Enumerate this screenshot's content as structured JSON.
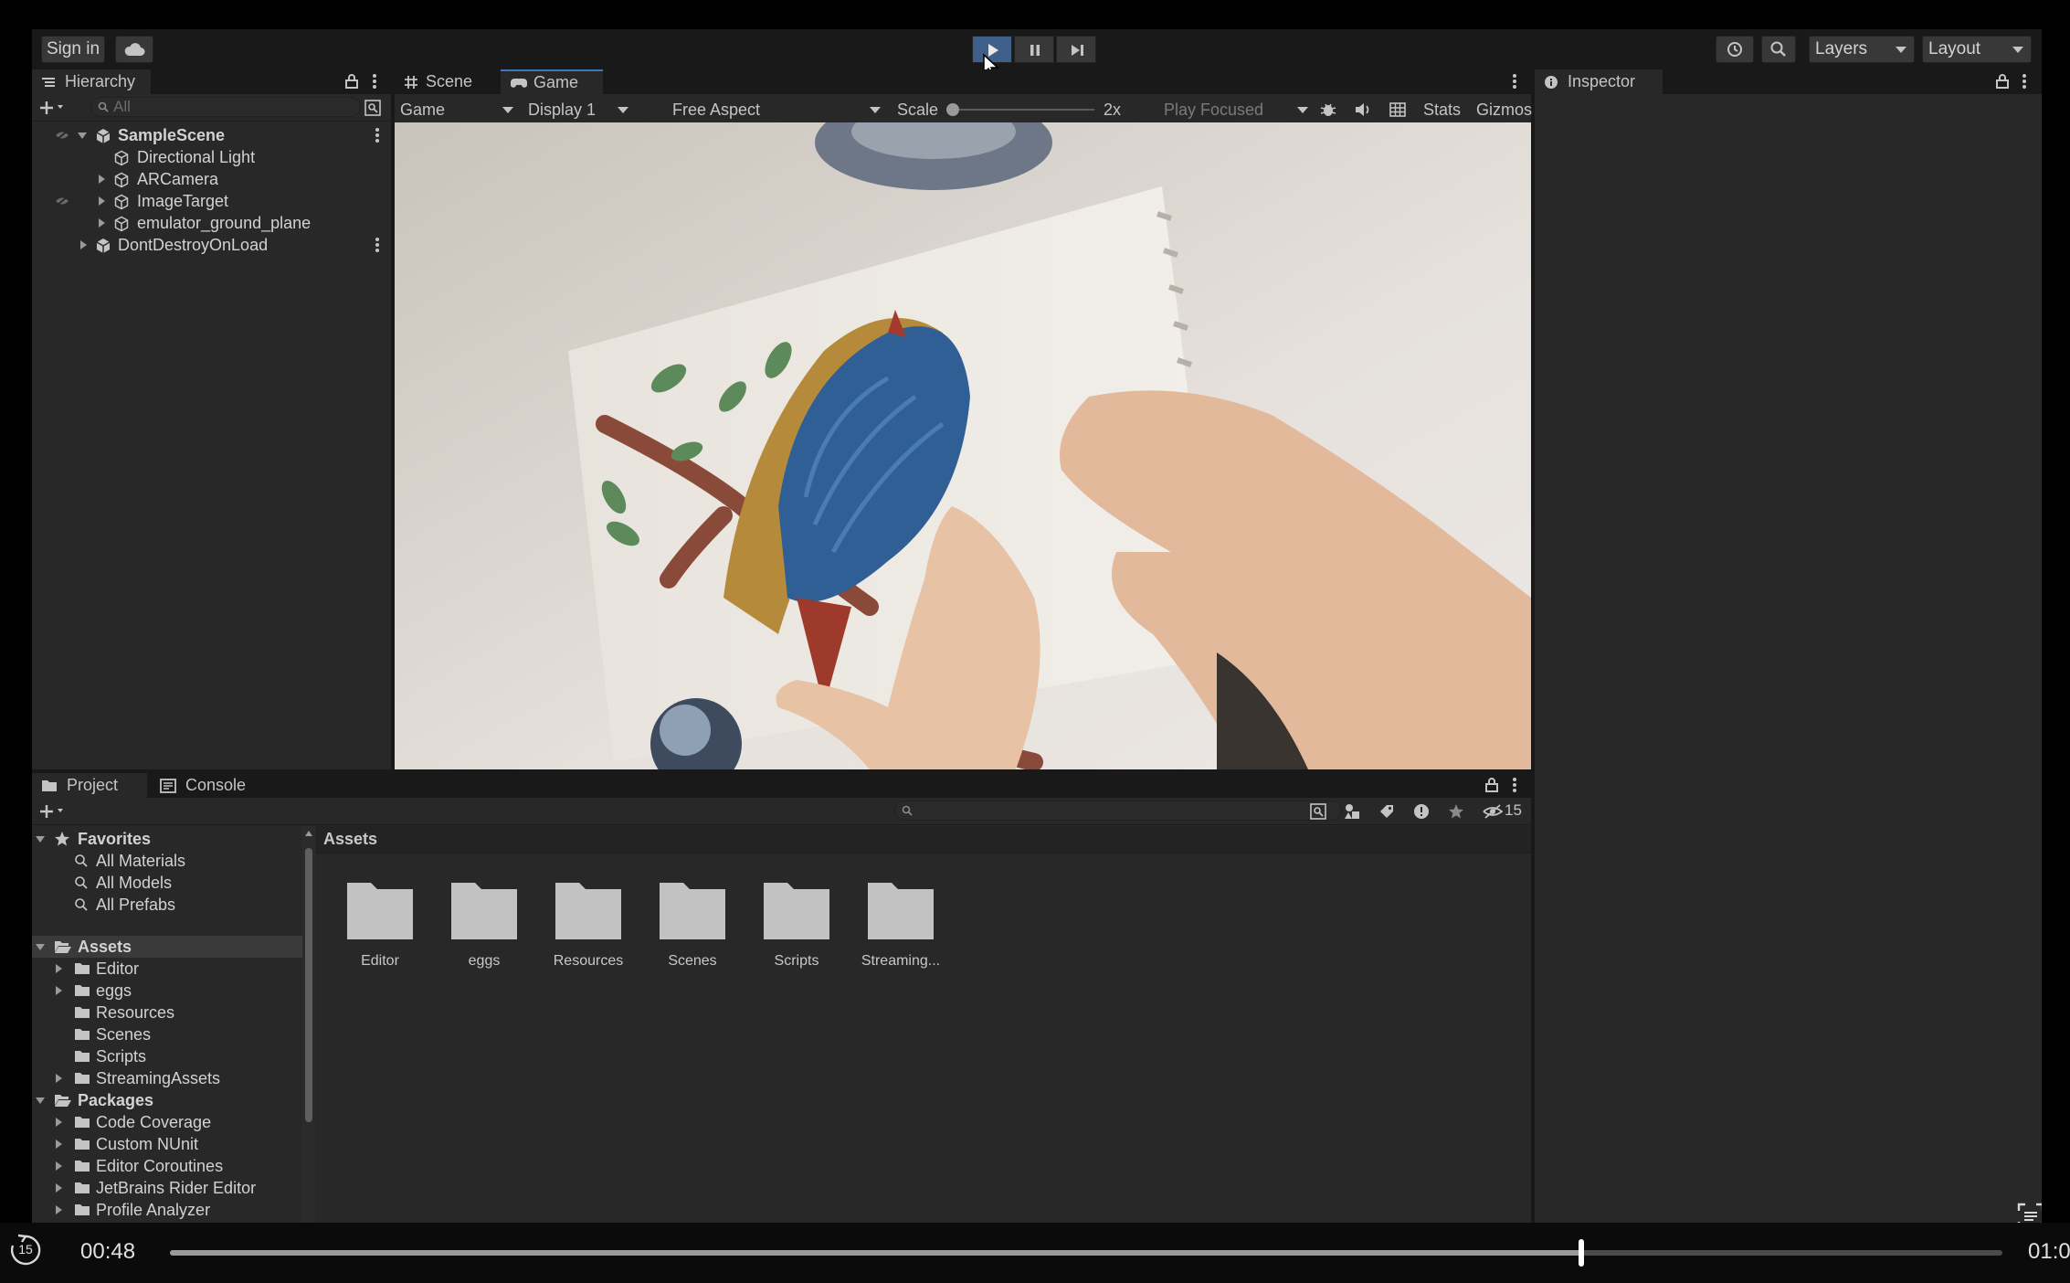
{
  "toolbar": {
    "sign_in": "Sign in",
    "layers": "Layers",
    "layout": "Layout"
  },
  "hierarchy": {
    "tab": "Hierarchy",
    "search_placeholder": "All",
    "items": [
      {
        "label": "SampleScene"
      },
      {
        "label": "Directional Light"
      },
      {
        "label": "ARCamera"
      },
      {
        "label": "ImageTarget"
      },
      {
        "label": "emulator_ground_plane"
      },
      {
        "label": "DontDestroyOnLoad"
      }
    ]
  },
  "scene_tabs": {
    "scene": "Scene",
    "game": "Game"
  },
  "game_toolbar": {
    "mode": "Game",
    "display": "Display 1",
    "aspect": "Free Aspect",
    "scale_label": "Scale",
    "scale_value": "2x",
    "play_focused": "Play Focused",
    "stats": "Stats",
    "gizmos": "Gizmos"
  },
  "inspector": {
    "tab": "Inspector"
  },
  "bottom_tabs": {
    "project": "Project",
    "console": "Console"
  },
  "project": {
    "hidden_count": "15",
    "breadcrumb": "Assets",
    "favorites": {
      "label": "Favorites",
      "items": [
        "All Materials",
        "All Models",
        "All Prefabs"
      ]
    },
    "assets": {
      "label": "Assets",
      "items": [
        "Editor",
        "eggs",
        "Resources",
        "Scenes",
        "Scripts",
        "StreamingAssets"
      ]
    },
    "packages": {
      "label": "Packages",
      "items": [
        "Code Coverage",
        "Custom NUnit",
        "Editor Coroutines",
        "JetBrains Rider Editor",
        "Profile Analyzer"
      ]
    },
    "grid": [
      "Editor",
      "eggs",
      "Resources",
      "Scenes",
      "Scripts",
      "Streaming..."
    ]
  },
  "player": {
    "skip_back": "15",
    "current_time": "00:48",
    "end_time": "01:0",
    "progress": 0.77
  }
}
